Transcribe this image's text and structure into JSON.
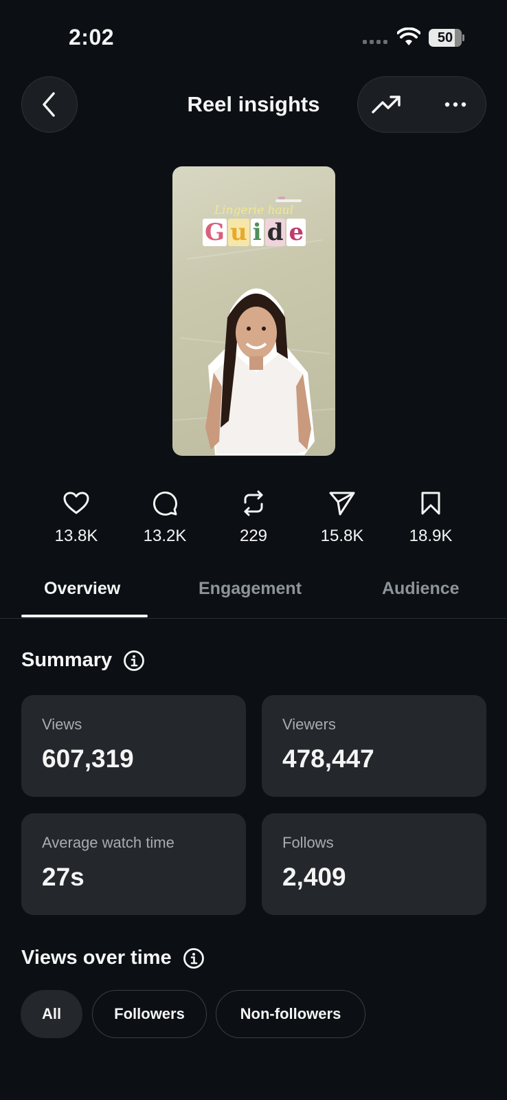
{
  "status_bar": {
    "time": "2:02",
    "battery": "50"
  },
  "header": {
    "title": "Reel insights"
  },
  "reel": {
    "overlay_script": "Lingerie haul",
    "overlay_title_letters": [
      "G",
      "u",
      "i",
      "d",
      "e"
    ]
  },
  "stats": [
    {
      "icon": "heart-icon",
      "value": "13.8K"
    },
    {
      "icon": "comment-icon",
      "value": "13.2K"
    },
    {
      "icon": "repost-icon",
      "value": "229"
    },
    {
      "icon": "share-icon",
      "value": "15.8K"
    },
    {
      "icon": "bookmark-icon",
      "value": "18.9K"
    }
  ],
  "tabs": [
    {
      "label": "Overview",
      "active": true
    },
    {
      "label": "Engagement",
      "active": false
    },
    {
      "label": "Audience",
      "active": false
    }
  ],
  "summary": {
    "title": "Summary",
    "cards": [
      {
        "label": "Views",
        "value": "607,319"
      },
      {
        "label": "Viewers",
        "value": "478,447"
      },
      {
        "label": "Average watch time",
        "value": "27s"
      },
      {
        "label": "Follows",
        "value": "2,409"
      }
    ]
  },
  "views_over_time": {
    "title": "Views over time",
    "filters": [
      {
        "label": "All",
        "active": true
      },
      {
        "label": "Followers",
        "active": false
      },
      {
        "label": "Non-followers",
        "active": false
      }
    ]
  },
  "colors": {
    "background": "#0c1014",
    "card": "#24272b",
    "text": "#f5f5f5",
    "muted": "#a7adb3"
  }
}
